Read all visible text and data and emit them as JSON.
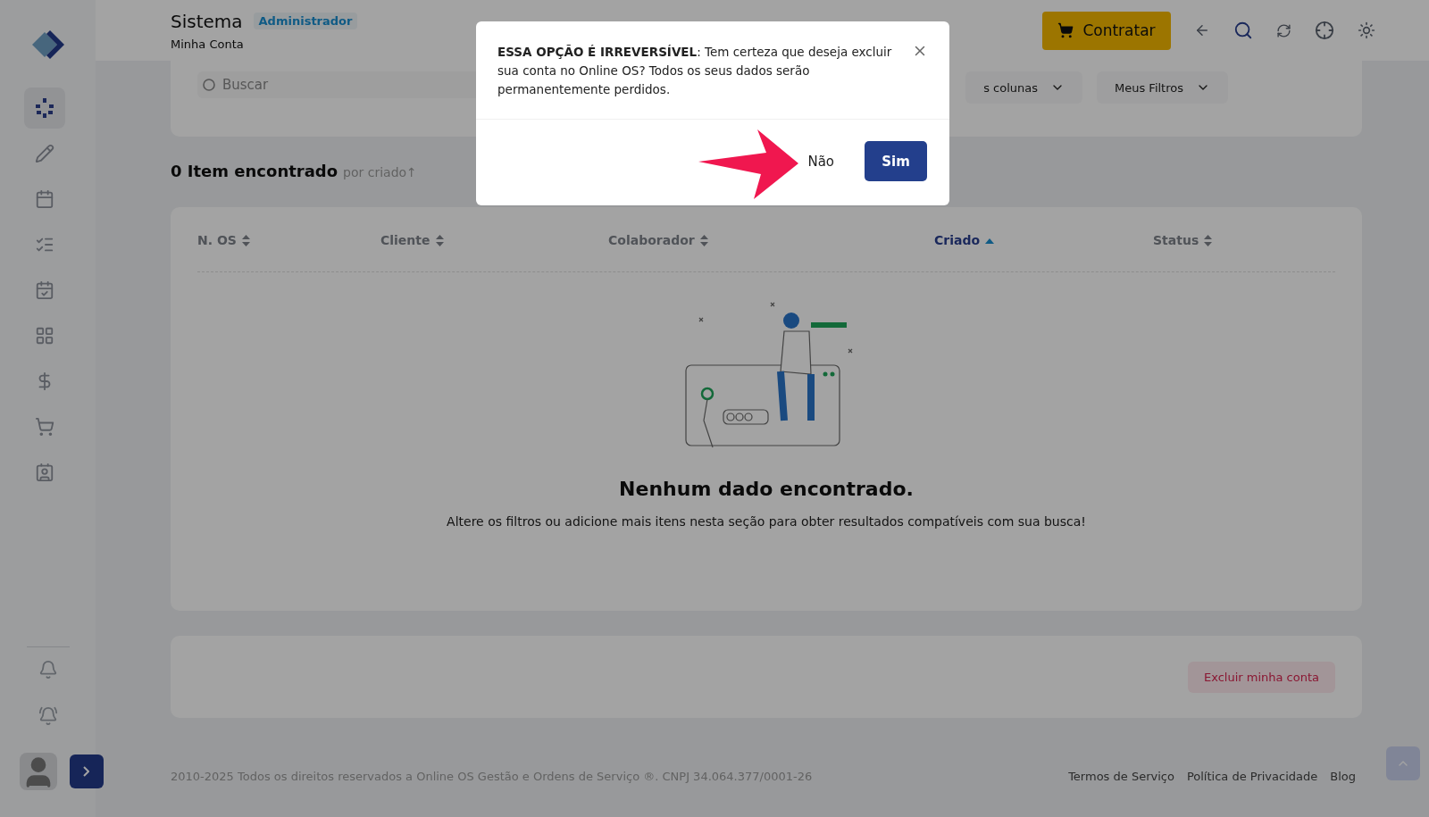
{
  "header": {
    "title": "Sistema",
    "badge": "Administrador",
    "subtitle": "Minha Conta",
    "cta": "Contratar"
  },
  "sidebar": {
    "items": [
      {
        "selected": true
      },
      {
        "selected": false
      },
      {
        "selected": false
      },
      {
        "selected": false
      },
      {
        "selected": false
      },
      {
        "selected": false
      },
      {
        "selected": false
      },
      {
        "selected": false
      },
      {
        "selected": false
      }
    ]
  },
  "search": {
    "placeholder": "Buscar"
  },
  "filters": [
    {
      "label": "s colunas"
    },
    {
      "label": "Meus Filtros"
    }
  ],
  "results": {
    "count": "0 Item encontrado",
    "sort": "por criado↑"
  },
  "table": {
    "columns": [
      {
        "label": "N. OS",
        "selected": false
      },
      {
        "label": "Cliente",
        "selected": false
      },
      {
        "label": "Colaborador",
        "selected": false
      },
      {
        "label": "Criado",
        "selected": true
      },
      {
        "label": "Status",
        "selected": false
      }
    ],
    "empty": {
      "title": "Nenhum dado encontrado.",
      "text": "Altere os filtros ou adicione mais itens nesta seção para obter resultados compatíveis com sua busca!"
    }
  },
  "danger": {
    "button": "Excluir minha conta"
  },
  "footer": {
    "copyright": "2010-2025 Todos os direitos reservados a Online OS Gestão e Ordens de Serviço ®. CNPJ 34.064.377/0001-26",
    "links": [
      "Termos de Serviço",
      "Política de Privacidade",
      "Blog"
    ]
  },
  "modal": {
    "message": "**ESSA OPÇÃO É IRREVERSÍVEL**: Tem certeza que deseja excluir sua conta no Online OS? Todos os seus dados serão permanentemente perdidos.",
    "cancel": "Não",
    "confirm": "Sim"
  }
}
